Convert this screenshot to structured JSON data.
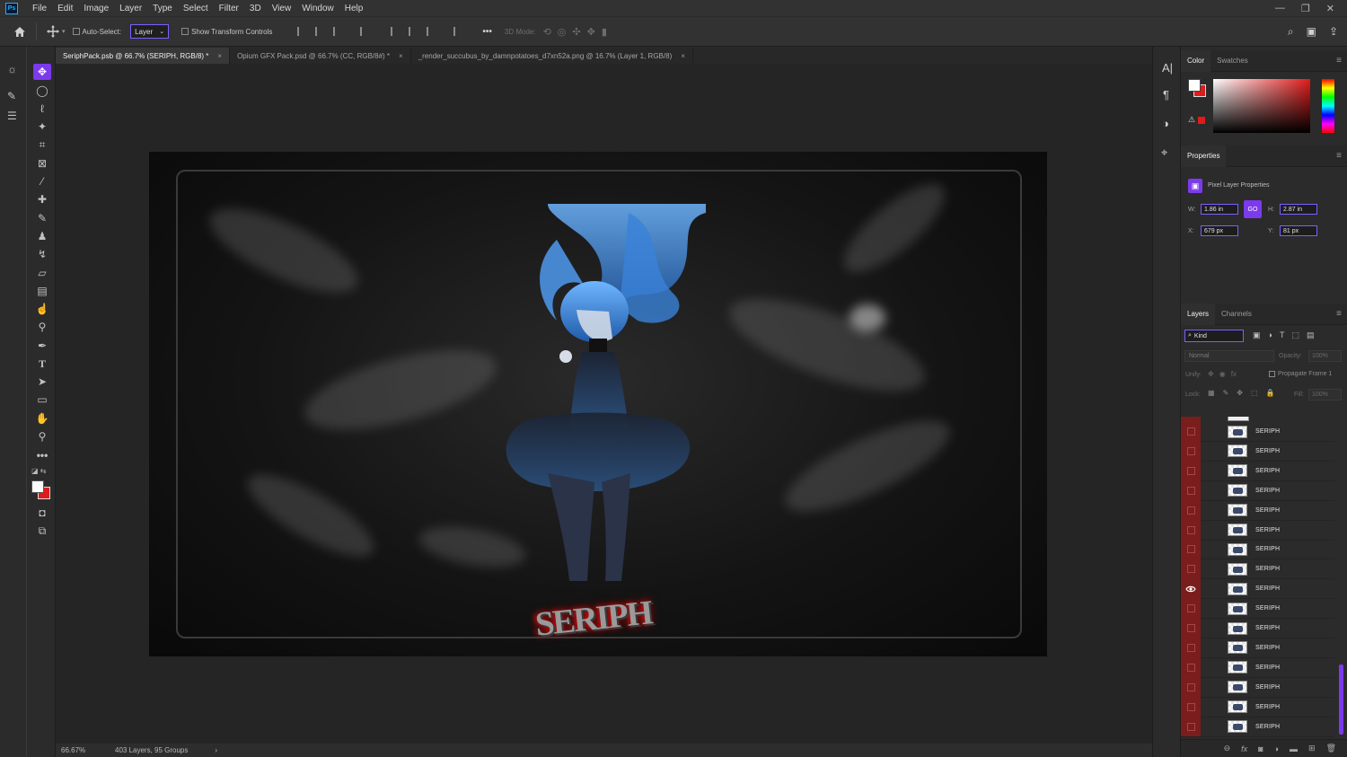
{
  "menu": {
    "logo": "Ps",
    "items": [
      "File",
      "Edit",
      "Image",
      "Layer",
      "Type",
      "Select",
      "Filter",
      "3D",
      "View",
      "Window",
      "Help"
    ],
    "window_buttons": [
      "—",
      "❐",
      "✕"
    ]
  },
  "options_bar": {
    "auto_select_label": "Auto-Select:",
    "auto_select_value": "Layer",
    "show_transform_label": "Show Transform Controls",
    "more_label": "•••",
    "mode_3d_label": "3D Mode:"
  },
  "tabs": [
    {
      "label": "SeriphPack.psb @ 66.7% (SERIPH, RGB/8) *",
      "close": "×"
    },
    {
      "label": "Opium GFX Pack.psd @ 66.7% (CC, RGB/8#) *",
      "close": "×"
    },
    {
      "label": "_render_succubus_by_damnpotatoes_d7xn52a.png @ 16.7% (Layer 1, RGB/8)",
      "close": "×"
    }
  ],
  "status_bar": {
    "zoom": "66.67%",
    "info": "403 Layers, 95 Groups",
    "arrow": "›"
  },
  "color_panel": {
    "tabs": [
      "Color",
      "Swatches"
    ],
    "foreground": "#ffffff",
    "background": "#e01b1b"
  },
  "properties_panel": {
    "title": "Properties",
    "subtitle": "Pixel Layer Properties",
    "w_label": "W:",
    "w_value": "1.86 in",
    "h_label": "H:",
    "h_value": "2.87 in",
    "x_label": "X:",
    "x_value": "679 px",
    "y_label": "Y:",
    "y_value": "81 px",
    "link_label": "GO"
  },
  "layers_panel": {
    "tabs": [
      "Layers",
      "Channels"
    ],
    "kind_label": "Kind",
    "blend_mode": "Normal",
    "opacity_label": "Opacity:",
    "opacity_value": "100%",
    "unify_label": "Unify:",
    "propagate_label": "Propagate Frame 1",
    "lock_label": "Lock:",
    "fill_label": "Fill:",
    "fill_value": "100%",
    "layers": [
      {
        "name": "SERIPH",
        "visible": false
      },
      {
        "name": "SERIPH",
        "visible": false
      },
      {
        "name": "SERIPH",
        "visible": false
      },
      {
        "name": "SERIPH",
        "visible": false
      },
      {
        "name": "SERIPH",
        "visible": false
      },
      {
        "name": "SERIPH",
        "visible": false
      },
      {
        "name": "SERIPH",
        "visible": false
      },
      {
        "name": "SERIPH",
        "visible": false
      },
      {
        "name": "SERIPH",
        "visible": true
      },
      {
        "name": "SERIPH",
        "visible": false
      },
      {
        "name": "SERIPH",
        "visible": false
      },
      {
        "name": "SERIPH",
        "visible": false
      },
      {
        "name": "SERIPH",
        "visible": false
      },
      {
        "name": "SERIPH",
        "visible": false
      },
      {
        "name": "SERIPH",
        "visible": false
      },
      {
        "name": "SERIPH",
        "visible": false
      }
    ],
    "bottom_icons": [
      "link-icon",
      "fx-icon",
      "mask-icon",
      "adjustment-icon",
      "folder-icon",
      "new-layer-icon",
      "trash-icon"
    ]
  },
  "canvas_text": "SERIPH"
}
